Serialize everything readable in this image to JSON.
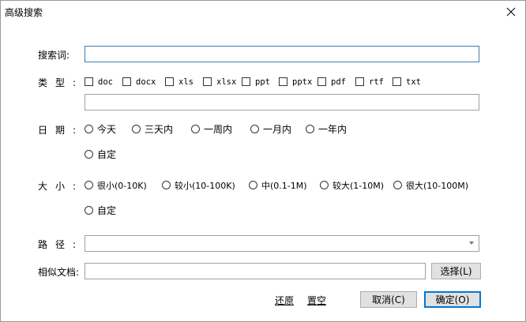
{
  "window": {
    "title": "高级搜索"
  },
  "search": {
    "label": "搜索词:",
    "value": ""
  },
  "type": {
    "label": "类型:",
    "options": [
      {
        "label": "doc",
        "checked": false
      },
      {
        "label": "docx",
        "checked": false
      },
      {
        "label": "xls",
        "checked": false
      },
      {
        "label": "xlsx",
        "checked": false
      },
      {
        "label": "ppt",
        "checked": false
      },
      {
        "label": "pptx",
        "checked": false
      },
      {
        "label": "pdf",
        "checked": false
      },
      {
        "label": "rtf",
        "checked": false
      },
      {
        "label": "txt",
        "checked": false
      }
    ],
    "custom_value": ""
  },
  "date": {
    "label": "日期:",
    "options": [
      "今天",
      "三天内",
      "一周内",
      "一月内",
      "一年内"
    ],
    "custom": "自定"
  },
  "size": {
    "label": "大小:",
    "options": [
      "很小(0-10K)",
      "较小(10-100K)",
      "中(0.1-1M)",
      "较大(1-10M)",
      "很大(10-100M)"
    ],
    "custom": "自定"
  },
  "path": {
    "label": "路径:",
    "value": ""
  },
  "similar": {
    "label": "相似文档:",
    "value": "",
    "choose_label": "选择(L)"
  },
  "footer": {
    "restore": "还原",
    "clear": "置空",
    "cancel": "取消(C)",
    "ok": "确定(O)"
  }
}
